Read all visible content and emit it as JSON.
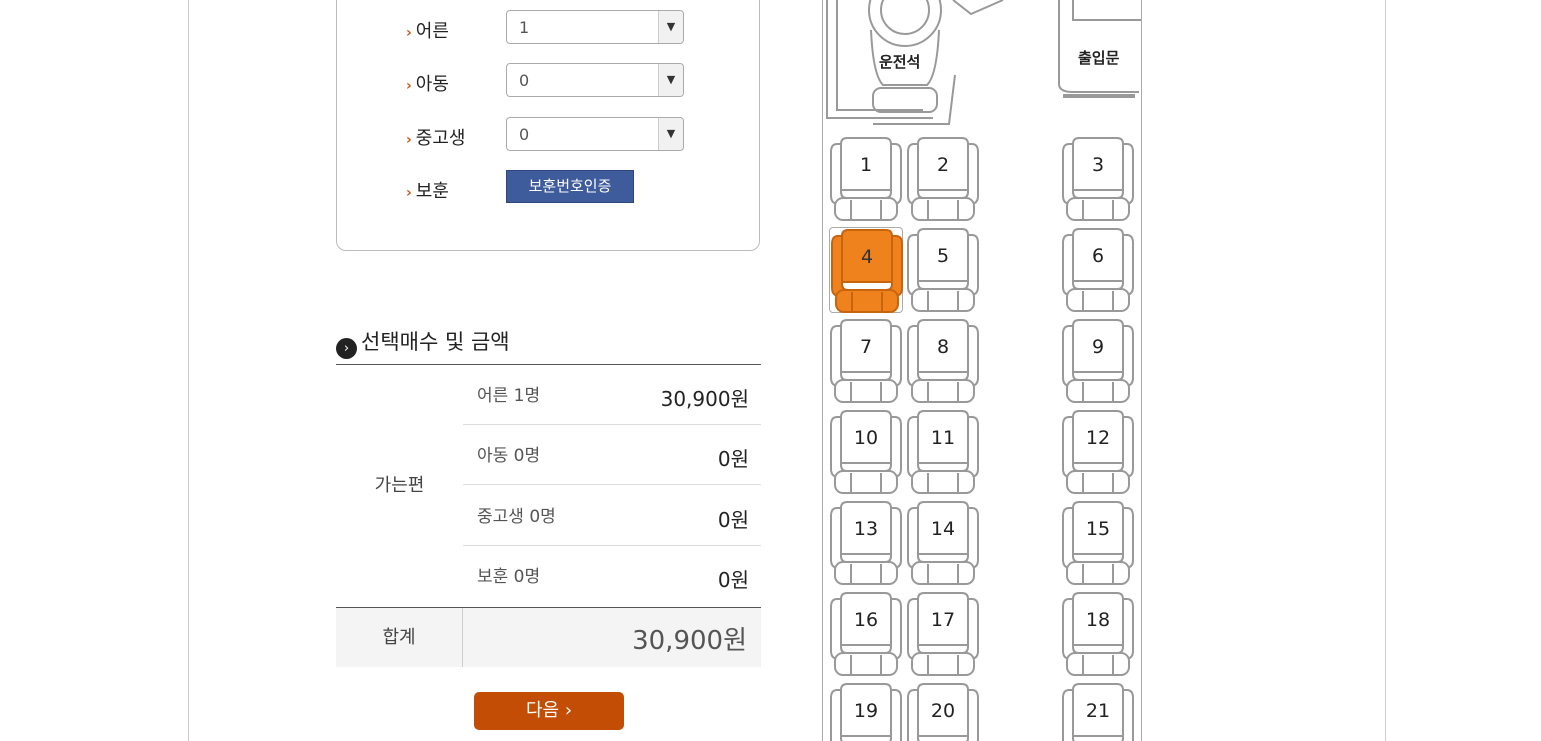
{
  "passengers": [
    {
      "label": "어른",
      "value": "1"
    },
    {
      "label": "아동",
      "value": "0"
    },
    {
      "label": "중고생",
      "value": "0"
    }
  ],
  "veteran": {
    "label": "보훈",
    "button": "보훈번호인증"
  },
  "summary": {
    "title": "선택매수 및 금액",
    "trip_label": "가는편",
    "lines": [
      {
        "label": "어른 1명",
        "amount": "30,900원"
      },
      {
        "label": "아동 0명",
        "amount": "0원"
      },
      {
        "label": "중고생 0명",
        "amount": "0원"
      },
      {
        "label": "보훈 0명",
        "amount": "0원"
      }
    ],
    "total_label": "합계",
    "total_amount": "30,900원"
  },
  "next_button": "다음",
  "bus": {
    "driver_label": "운전석",
    "door_label": "출입문",
    "selected_seat": "4",
    "selected_color": "#f0821e",
    "seats": [
      "1",
      "2",
      "3",
      "4",
      "5",
      "6",
      "7",
      "8",
      "9",
      "10",
      "11",
      "12",
      "13",
      "14",
      "15",
      "16",
      "17",
      "18",
      "19",
      "20",
      "21"
    ]
  },
  "colors": {
    "accent": "#c34d04",
    "verify_button": "#3e5b9b",
    "arrow": "#c85a16"
  }
}
